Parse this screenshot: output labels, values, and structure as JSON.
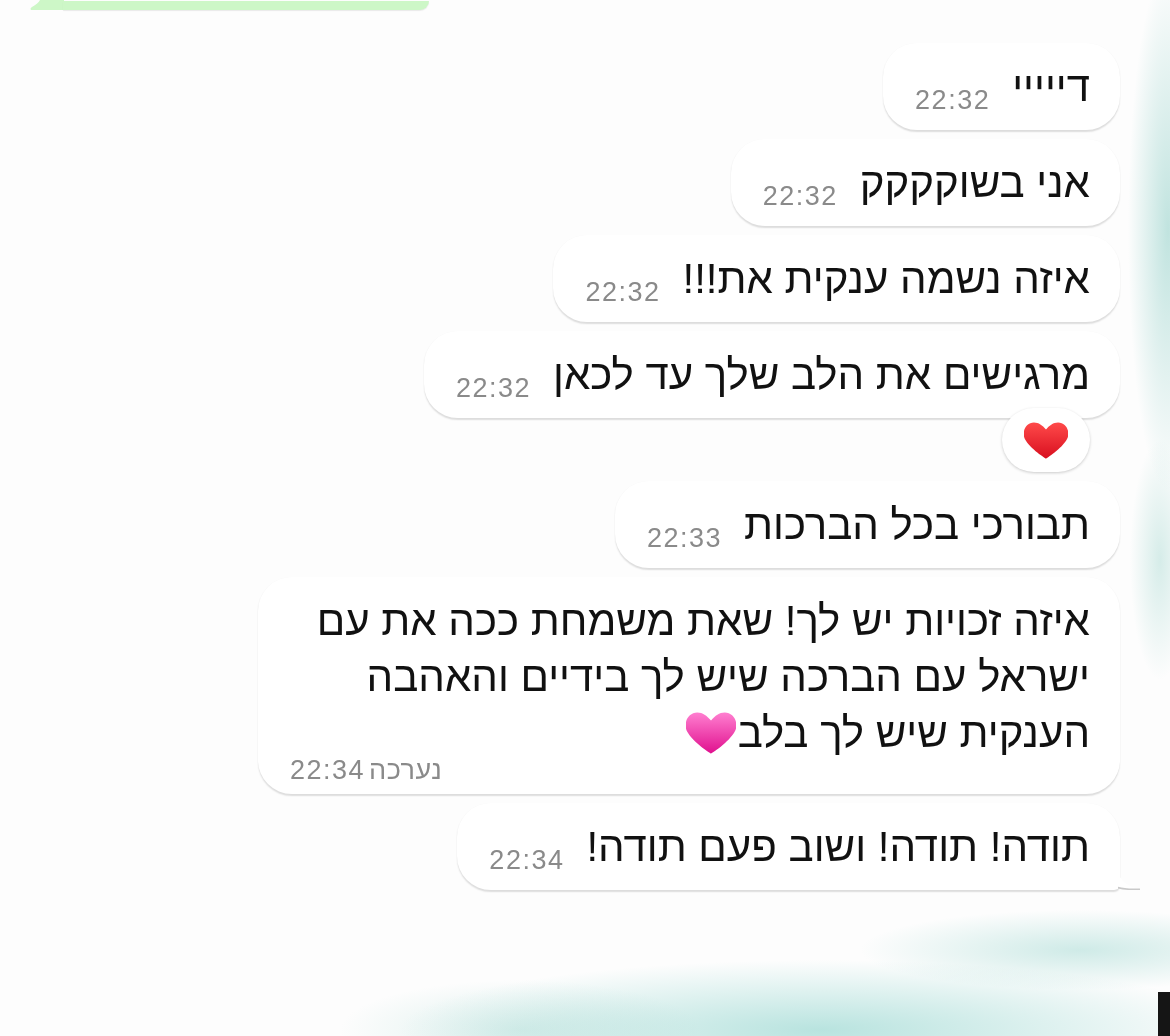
{
  "chat": {
    "messages": [
      {
        "kind": "outgoing",
        "tail": true
      },
      {
        "kind": "incoming",
        "text": "דייייי",
        "time": "22:32",
        "tail": false,
        "reacted": false,
        "ends_with_emoji": false
      },
      {
        "kind": "incoming",
        "text": "אני בשוקקקק",
        "time": "22:32",
        "tail": false,
        "reacted": false,
        "ends_with_emoji": false
      },
      {
        "kind": "incoming",
        "text": "איזה נשמה ענקית את!!!",
        "time": "22:32",
        "tail": false,
        "reacted": false,
        "ends_with_emoji": false
      },
      {
        "kind": "incoming",
        "text": "מרגישים את הלב שלך עד לכאן",
        "time": "22:32",
        "tail": false,
        "reacted": true,
        "ends_with_emoji": false
      },
      {
        "kind": "incoming",
        "text": "תבורכי בכל הברכות",
        "time": "22:33",
        "tail": false,
        "reacted": false,
        "ends_with_emoji": false
      },
      {
        "kind": "incoming",
        "text": "איזה זכויות יש לך! שאת משמחת ככה את עם ישראל עם הברכה שיש לך בידיים והאהבה הענקית שיש לך בלב",
        "edited_label": "נערכה",
        "time": "22:34",
        "tail": false,
        "reacted": false,
        "ends_with_emoji": true
      },
      {
        "kind": "incoming",
        "text": "תודה! תודה! ושוב פעם תודה!",
        "time": "22:34",
        "tail": true,
        "reacted": false,
        "ends_with_emoji": false
      }
    ]
  }
}
